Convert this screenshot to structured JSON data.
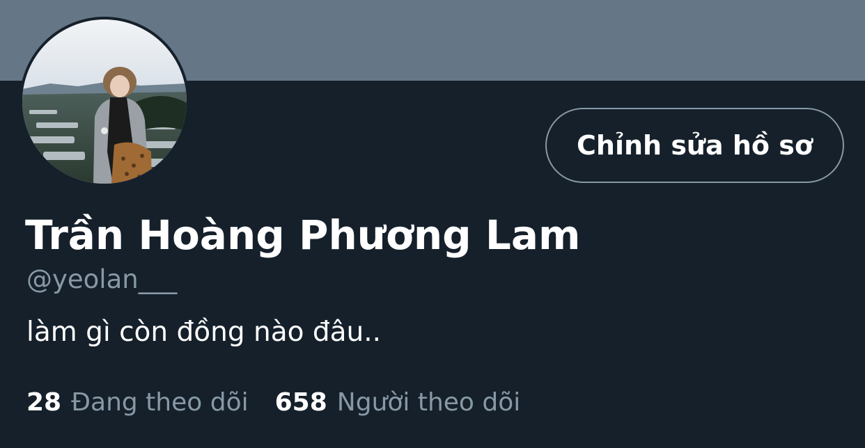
{
  "colors": {
    "background": "#15202b",
    "banner": "#657786",
    "primary_text": "#ffffff",
    "secondary_text": "#8899a6",
    "button_border": "#8899a6"
  },
  "profile": {
    "avatar_icon": "avatar-photo",
    "edit_button_label": "Chỉnh sửa hồ sơ",
    "display_name": "Trần Hoàng Phương Lam",
    "handle": "@yeolan___",
    "bio": "làm gì còn đồng nào đâu.."
  },
  "stats": {
    "following_count": "28",
    "following_label": "Đang theo dõi",
    "followers_count": "658",
    "followers_label": "Người theo dõi"
  }
}
